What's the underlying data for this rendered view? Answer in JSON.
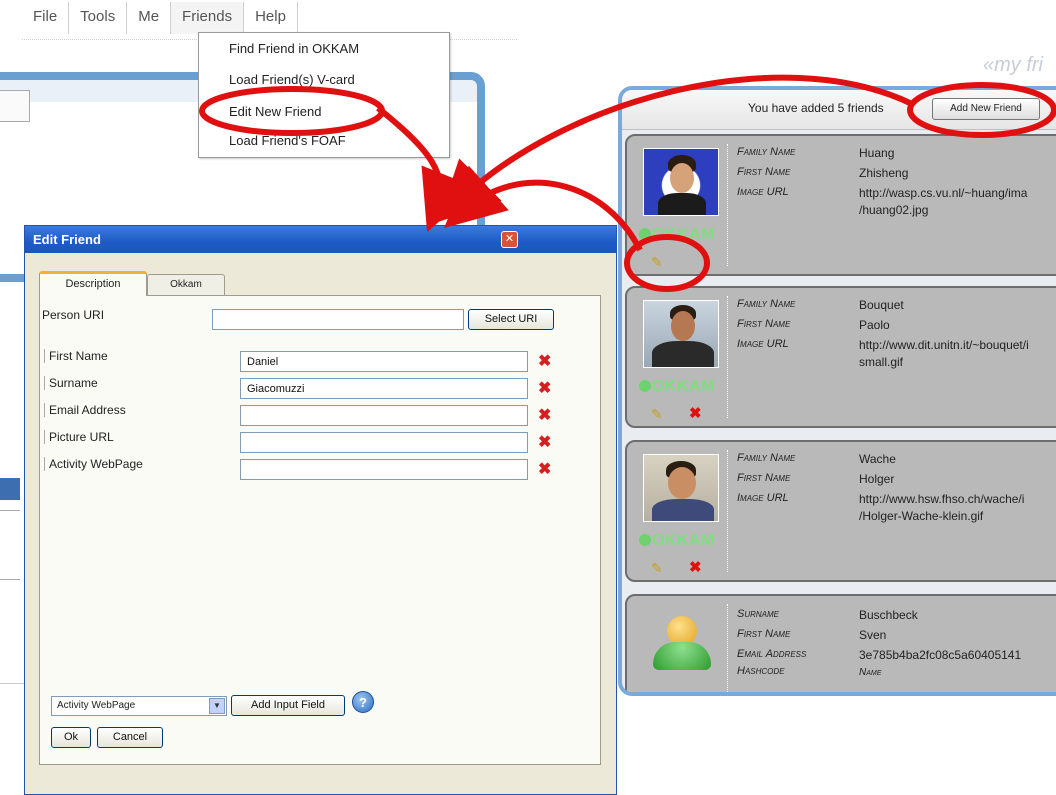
{
  "menu": {
    "items": [
      {
        "label": "File"
      },
      {
        "label": "Tools"
      },
      {
        "label": "Me"
      },
      {
        "label": "Friends"
      },
      {
        "label": "Help"
      }
    ]
  },
  "friends_menu": {
    "items": [
      {
        "label": "Find Friend in OKKAM"
      },
      {
        "label": "Load Friend(s) V-card"
      },
      {
        "label": "Edit New Friend"
      },
      {
        "label": "Load Friend's FOAF"
      }
    ]
  },
  "my_friends": {
    "title": "«my fri",
    "added_text": "You have added 5 friends",
    "add_button": "Add New Friend",
    "okkam_label": "OKKAM",
    "friends": [
      {
        "rows": [
          {
            "label": "Family Name",
            "value": "Huang"
          },
          {
            "label": "First Name",
            "value": "Zhisheng"
          },
          {
            "label": "Image URL",
            "value": "http://wasp.cs.vu.nl/~huang/ima"
          },
          {
            "label": "",
            "value": "/huang02.jpg"
          }
        ]
      },
      {
        "rows": [
          {
            "label": "Family Name",
            "value": "Bouquet"
          },
          {
            "label": "First Name",
            "value": "Paolo"
          },
          {
            "label": "Image URL",
            "value": "http://www.dit.unitn.it/~bouquet/i"
          },
          {
            "label": "",
            "value": "small.gif"
          }
        ]
      },
      {
        "rows": [
          {
            "label": "Family Name",
            "value": "Wache"
          },
          {
            "label": "First Name",
            "value": "Holger"
          },
          {
            "label": "Image URL",
            "value": "http://www.hsw.fhso.ch/wache/i"
          },
          {
            "label": "",
            "value": "/Holger-Wache-klein.gif"
          }
        ]
      },
      {
        "rows": [
          {
            "label": "Surname",
            "value": "Buschbeck"
          },
          {
            "label": "First Name",
            "value": "Sven"
          },
          {
            "label": "Email Address",
            "value": "3e785b4ba2fc08c5a60405141"
          },
          {
            "label": "Hashcode",
            "value": "Name"
          }
        ]
      }
    ]
  },
  "dialog": {
    "title": "Edit Friend",
    "tabs": [
      "Description",
      "Okkam"
    ],
    "person_uri_label": "Person URI",
    "select_uri_button": "Select URI",
    "fields": [
      {
        "label": "First Name",
        "value": ""
      },
      {
        "label": "Surname",
        "value": ""
      },
      {
        "label": "Email Address",
        "value": ""
      },
      {
        "label": "Picture URL",
        "value": ""
      },
      {
        "label": "Activity WebPage",
        "value": ""
      }
    ],
    "field_values": [
      "Daniel",
      "Giacomuzzi",
      "",
      "",
      ""
    ],
    "field_type_select": "Activity WebPage",
    "add_field_button": "Add Input Field",
    "ok_button": "Ok",
    "cancel_button": "Cancel"
  },
  "colors": {
    "annotation_red": "#e01010",
    "dialog_title_blue": "#1e5bc6",
    "panel_border_blue": "#7aaadb"
  }
}
